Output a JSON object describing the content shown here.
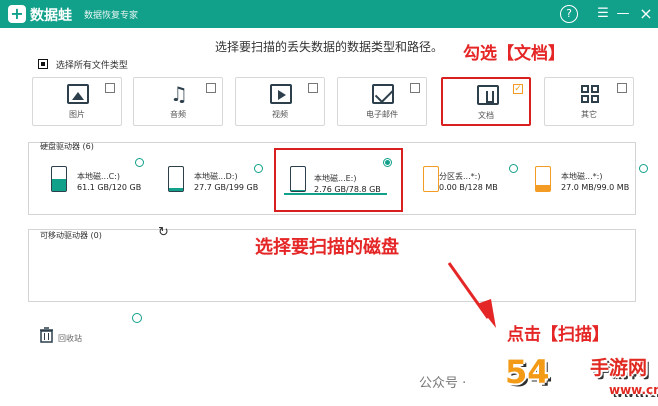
{
  "titlebar": {
    "app_name": "数据蛙",
    "app_subtitle": "数据恢复专家",
    "help_icon": "help-icon",
    "menu_icon": "menu-icon",
    "minimize_icon": "minimize-icon",
    "close_icon": "close-icon",
    "accent": "#11a08a"
  },
  "instruction": "选择要扫描的丢失数据的数据类型和路径。",
  "select_all": {
    "label": "选择所有文件类型",
    "checked": true
  },
  "file_types": [
    {
      "label": "图片",
      "icon": "photo-icon",
      "checked": false
    },
    {
      "label": "音频",
      "icon": "music-icon",
      "checked": false
    },
    {
      "label": "视频",
      "icon": "video-icon",
      "checked": false
    },
    {
      "label": "电子邮件",
      "icon": "mail-icon",
      "checked": false
    },
    {
      "label": "文档",
      "icon": "document-icon",
      "checked": true
    },
    {
      "label": "其它",
      "icon": "other-icon",
      "checked": false
    }
  ],
  "hard_drives": {
    "title": "硬盘驱动器 (6)",
    "items": [
      {
        "name": "本地磁...C:)",
        "size": "61.1 GB/120 GB",
        "usage": 0.51,
        "color": "#11a08a",
        "selected": false
      },
      {
        "name": "本地磁...D:)",
        "size": "27.7 GB/199 GB",
        "usage": 0.14,
        "color": "#11a08a",
        "selected": false
      },
      {
        "name": "本地磁...E:)",
        "size": "2.76 GB/78.8 GB",
        "usage": 0.04,
        "color": "#11a08a",
        "selected": true
      },
      {
        "name": "分区丢...*:)",
        "size": "0.00 B/128 MB",
        "usage": 0.0,
        "color": "#f49b23",
        "selected": false
      },
      {
        "name": "本地磁...*:)",
        "size": "27.0 MB/99.0 MB",
        "usage": 0.27,
        "color": "#f49b23",
        "selected": false
      }
    ]
  },
  "removable": {
    "title": "可移动驱动器 (0)",
    "refresh_icon": "refresh-icon"
  },
  "recycle": {
    "label": "回收站",
    "icon": "trash-icon"
  },
  "annotations": {
    "check_docs": "勾选【文档】",
    "choose_disk": "选择要扫描的磁盘",
    "click_scan": "点击【扫描】"
  },
  "watermark": {
    "wechat": "公众号 ·",
    "logo": "54",
    "logo_text": "手游网",
    "domain": "www.cn"
  }
}
